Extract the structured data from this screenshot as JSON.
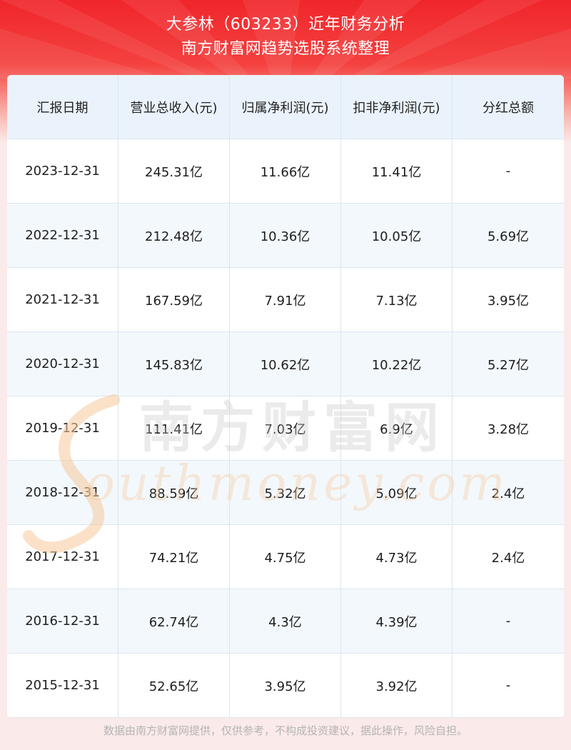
{
  "header": {
    "title_line1": "大参林（603233）近年财务分析",
    "title_line2": "南方财富网趋势选股系统整理"
  },
  "colors": {
    "header_red": "#f0262b",
    "table_header_bg": "#eaf3fc",
    "stripe_bg": "#f3f8fc",
    "watermark_orange": "#f6c99a"
  },
  "table": {
    "columns": [
      "汇报日期",
      "营业总收入(元)",
      "归属净利润(元)",
      "扣非净利润(元)",
      "分红总额"
    ],
    "rows": [
      [
        "2023-12-31",
        "245.31亿",
        "11.66亿",
        "11.41亿",
        "-"
      ],
      [
        "2022-12-31",
        "212.48亿",
        "10.36亿",
        "10.05亿",
        "5.69亿"
      ],
      [
        "2021-12-31",
        "167.59亿",
        "7.91亿",
        "7.13亿",
        "3.95亿"
      ],
      [
        "2020-12-31",
        "145.83亿",
        "10.62亿",
        "10.22亿",
        "5.27亿"
      ],
      [
        "2019-12-31",
        "111.41亿",
        "7.03亿",
        "6.9亿",
        "3.28亿"
      ],
      [
        "2018-12-31",
        "88.59亿",
        "5.32亿",
        "5.09亿",
        "2.4亿"
      ],
      [
        "2017-12-31",
        "74.21亿",
        "4.75亿",
        "4.73亿",
        "2.4亿"
      ],
      [
        "2016-12-31",
        "62.74亿",
        "4.3亿",
        "4.39亿",
        "-"
      ],
      [
        "2015-12-31",
        "52.65亿",
        "3.95亿",
        "3.92亿",
        "-"
      ]
    ]
  },
  "watermark": {
    "cn": "南方财富网",
    "en": "outhmoney.com"
  },
  "footer": {
    "disclaimer": "数据由南方财富网提供，仅供参考，不构成投资建议，据此操作，风险自担。"
  }
}
